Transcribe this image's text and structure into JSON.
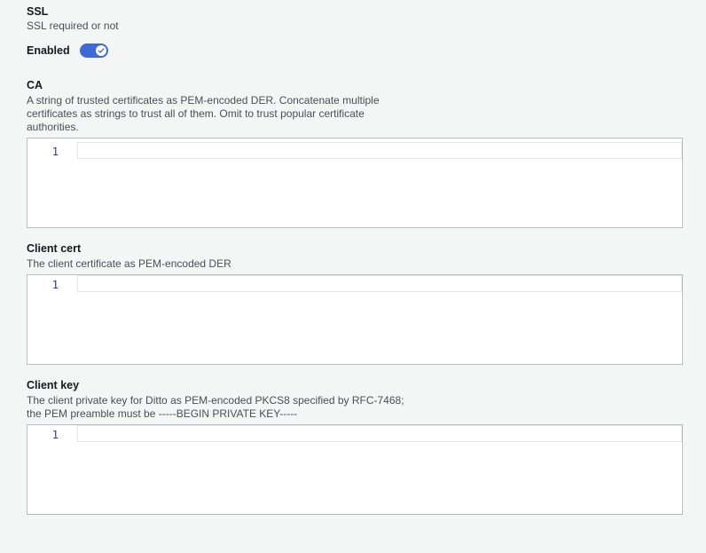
{
  "ssl": {
    "title": "SSL",
    "description": "SSL required or not",
    "toggle_label": "Enabled",
    "toggle_on": true,
    "toggle_color": "#3d6ad6"
  },
  "ca": {
    "title": "CA",
    "description_lines": [
      "A string of trusted certificates as PEM-encoded DER. Concatenate multiple",
      "certificates as strings to trust all of them. Omit to trust popular certificate",
      "authorities."
    ],
    "line_number": "1",
    "value": ""
  },
  "client_cert": {
    "title": "Client cert",
    "description_lines": [
      "The client certificate as PEM-encoded DER"
    ],
    "line_number": "1",
    "value": ""
  },
  "client_key": {
    "title": "Client key",
    "description_lines": [
      "The client private key for Ditto as PEM-encoded PKCS8 specified by RFC-7468;",
      "the PEM preamble must be -----BEGIN PRIVATE KEY-----"
    ],
    "line_number": "1",
    "value": ""
  }
}
